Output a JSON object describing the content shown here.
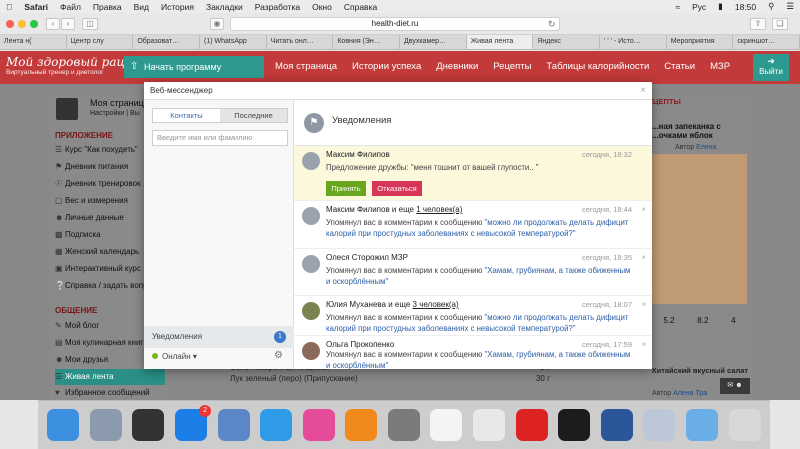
{
  "menubar": {
    "apple": "",
    "items": [
      "Safari",
      "Файл",
      "Правка",
      "Вид",
      "История",
      "Закладки",
      "Разработка",
      "Окно",
      "Справка"
    ],
    "lang": "Рус",
    "time": "18:50"
  },
  "browser": {
    "url": "health-diet.ru",
    "tabs": [
      "Лента н(",
      "Центр слу",
      "Образоват…",
      "(1) WhatsApp",
      "Читать онл…",
      "Ковния (Эн…",
      "Двухкамер…",
      "Живая лента",
      "Яндекс",
      "' ' ' - Исто…",
      "Мероприятия",
      "скриншот…"
    ]
  },
  "site": {
    "logo_title": "Мой здоровый рацион",
    "logo_subtitle": "Виртуальный тренер и диетолог",
    "cta": "Начать программу похудения",
    "nav": [
      "Моя страница",
      "Истории успеха",
      "Дневники",
      "Рецепты",
      "Таблицы калорийности",
      "Статьи",
      "МЗР"
    ],
    "exit": "Выйти"
  },
  "sidebar": {
    "user_name": "Моя страниц",
    "user_sub": "Настройки | Вы",
    "section_app": "ПРИЛОЖЕНИЕ",
    "app_items": [
      "Курс \"Как похудеть\"",
      "Дневник питания",
      "Дневник тренировок",
      "Вес и измерения",
      "Личные данные",
      "Подписка",
      "Женский календарь",
      "Интерактивный курс",
      "Справка / задать вопр"
    ],
    "section_social": "ОБЩЕНИЕ",
    "social_items": [
      "Мой блог",
      "Моя кулинарная книг",
      "Мои друзья",
      "Живая лента",
      "Избранное сообщений"
    ]
  },
  "rightcol": {
    "label": "ЕЦЕПТЫ",
    "title": "...ная запеканка с ...очками яблок",
    "author_prefix": "Автор",
    "author": "Елена",
    "stats": [
      "5.2",
      "8.2",
      "4"
    ],
    "title2": "Китайский вкусный салат",
    "author2_prefix": "Автор",
    "author2": "Алена Тра"
  },
  "behind": {
    "rows": [
      {
        "name": "Соль поваренная пищевая",
        "value": "2 г"
      },
      {
        "name": "Лук зеленый (перо) (Припускание)",
        "value": "30 г"
      }
    ]
  },
  "messenger": {
    "title": "Веб-мессенджер",
    "tab_contacts": "Контакты",
    "tab_recent": "Последние",
    "search_placeholder": "Введите имя или фамилию",
    "notifications_label": "Уведомления",
    "notifications_count": "1",
    "status": "Онлайн",
    "header": "Уведомления",
    "items": [
      {
        "name": "Максим Филипов",
        "time": "сегодня, 18:32",
        "text": "Предложение дружбы: \"меня тошнит от вашей глупости.. \"",
        "accept": "Принять",
        "decline": "Отказаться"
      },
      {
        "name": "Максим Филипов и еще ",
        "link": "1 человек(а)",
        "time": "сегодня, 18:44",
        "text": "Упомянул вас в комментарии к сообщению ",
        "quote": "\"можно ли продолжать делать дифицит калорий при простудных заболеваниях с невысокой температурой?\""
      },
      {
        "name": "Олеся Сторожил МЗР",
        "time": "сегодня, 18:35",
        "text": "Упомянул вас в комментарии к сообщению ",
        "quote": "\"Хамам, грубиянам, а также обиженным и оскорблённым\""
      },
      {
        "name": "Юлия Муханева и еще ",
        "link": "3 человек(а)",
        "time": "сегодня, 18:07",
        "text": "Упомянул вас в комментарии к сообщению ",
        "quote": "\"можно ли продолжать делать дифицит калорий при простудных заболеваниях с невысокой температурой?\""
      },
      {
        "name": "Ольга Прокопенко",
        "time": "сегодня, 17:59",
        "text": "Упомянул вас в комментарии к сообщению ",
        "quote": "\"Хамам, грубиянам, а также обиженным и оскорблённым\""
      }
    ]
  },
  "dock": {
    "badge": "2"
  },
  "colors": {
    "brand_red": "#c23a3a",
    "brand_teal": "#2e9a8f",
    "accept_green": "#6aa51f",
    "decline_red": "#d8355a",
    "link_blue": "#2c5ea8"
  }
}
